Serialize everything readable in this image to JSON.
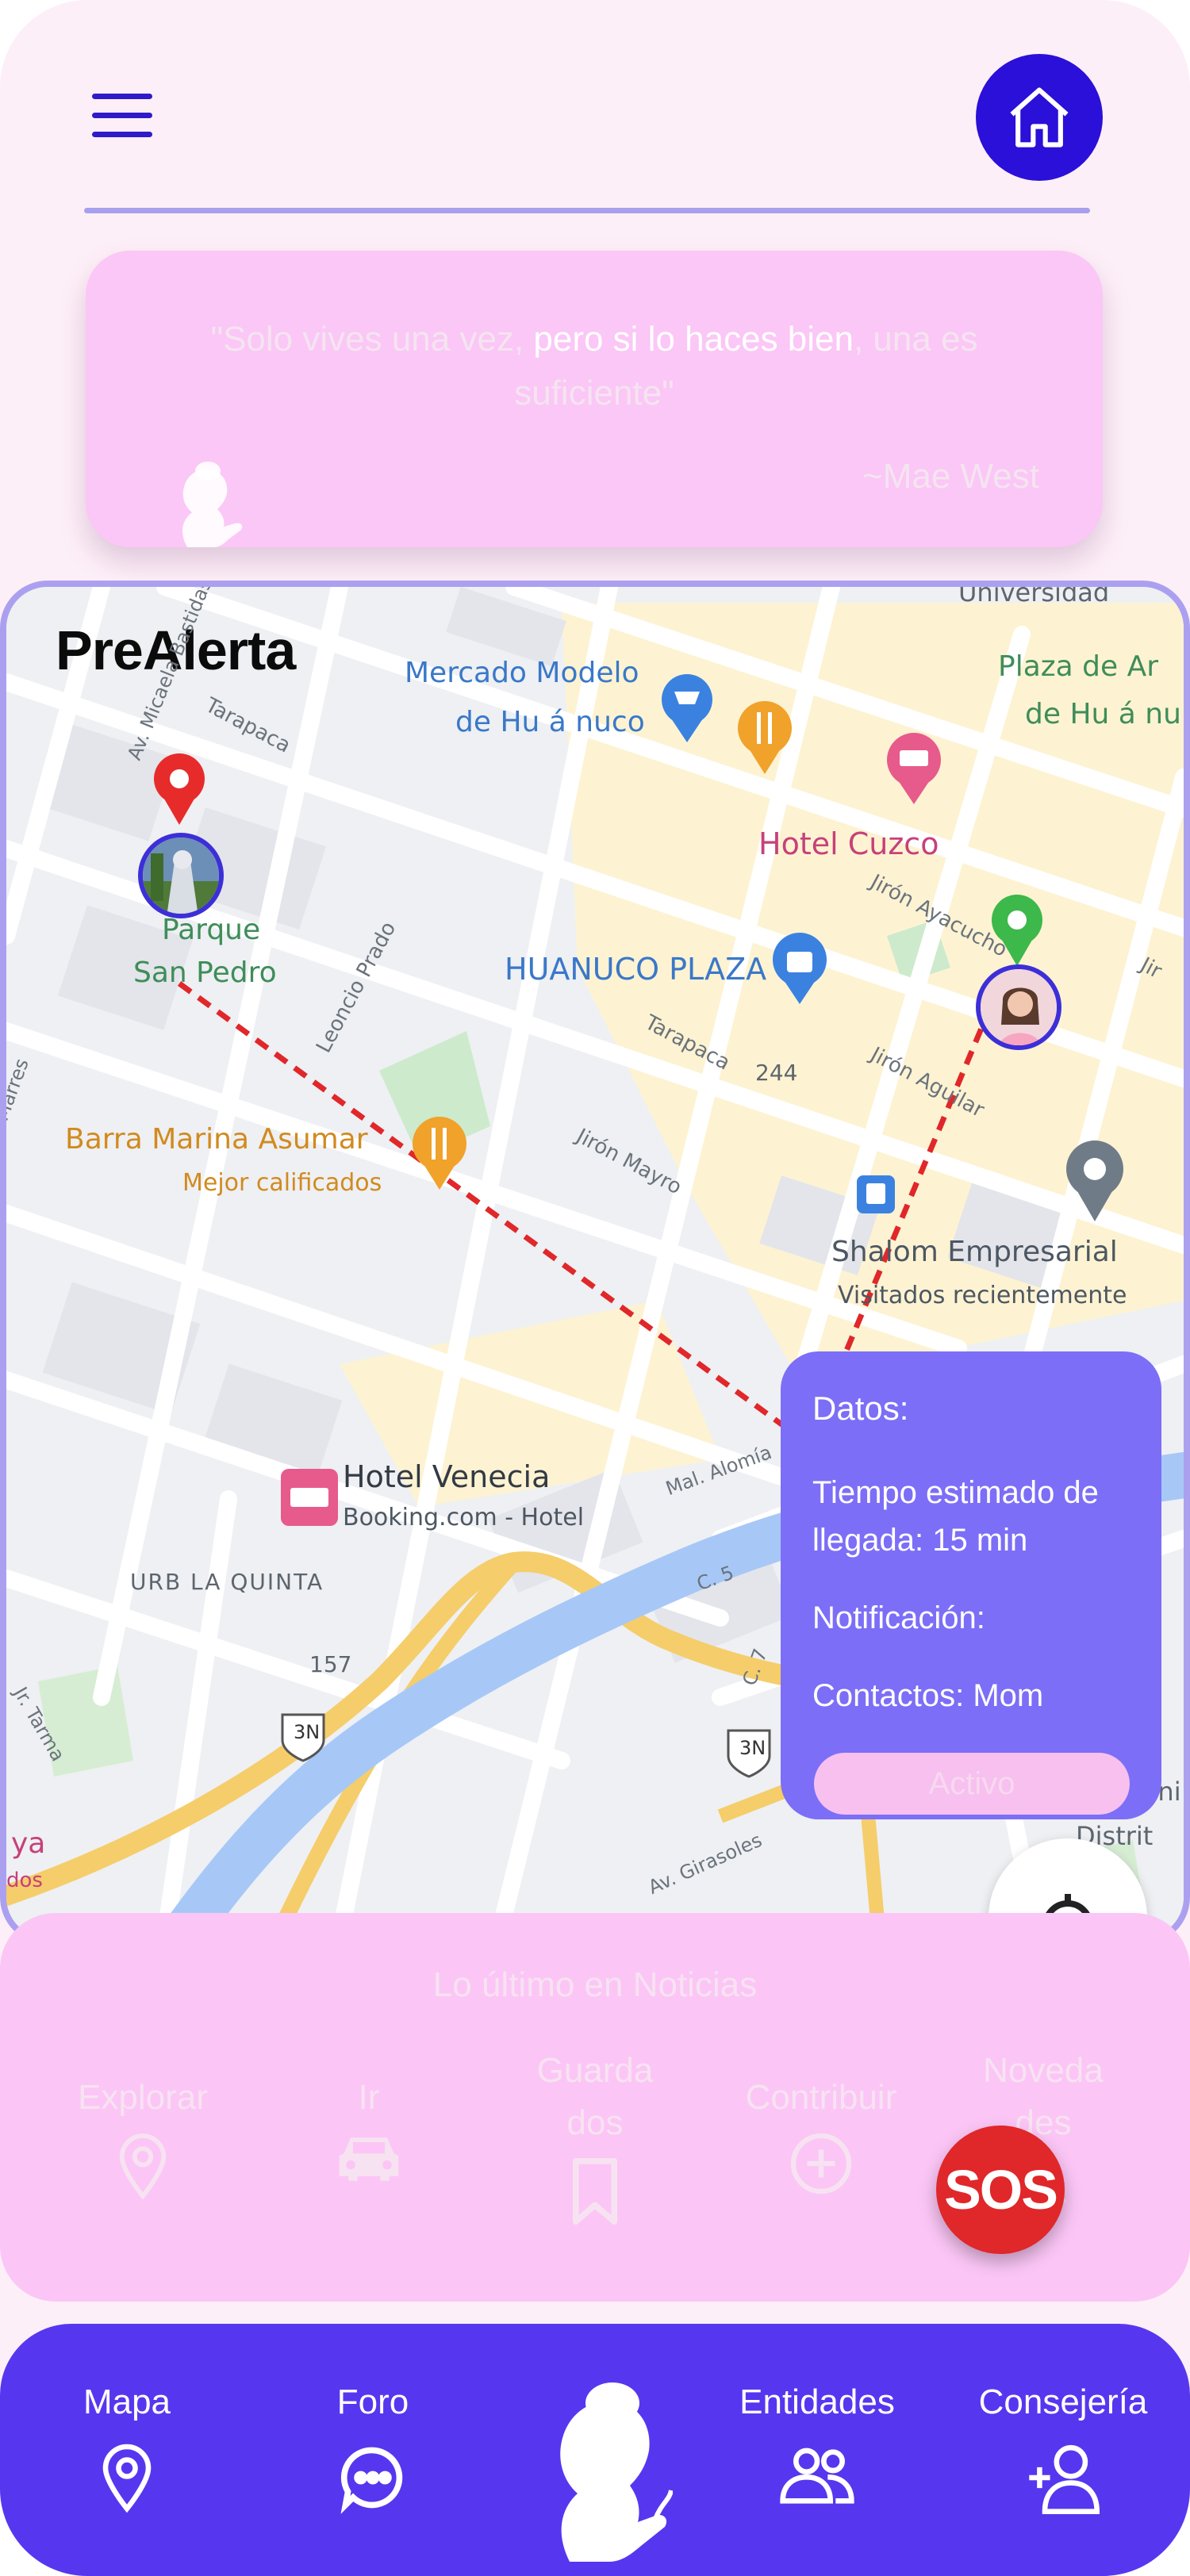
{
  "header": {
    "menu_icon": "hamburger-menu-icon",
    "home_icon": "home-icon"
  },
  "quote": {
    "part1": "\"Solo vives una vez, ",
    "highlight": "pero si lo haces bien",
    "part2": ", una es suficiente\"",
    "author": "~Mae West"
  },
  "map": {
    "app_title": "PreAlerta",
    "labels": {
      "mercado1": "Mercado Modelo",
      "mercado2": "de Hu á nuco",
      "plaza1": "Plaza de Ar",
      "plaza2": "de Hu á nu",
      "hotel_cuzco": "Hotel Cuzco",
      "parque1": "Parque",
      "parque2": "San Pedro",
      "huanuco_plaza": "HUANUCO PLAZA",
      "barra1": "Barra Marina Asumar",
      "barra2": "Mejor calificados",
      "shalom1": "Shalom Empresarial",
      "shalom2": "Visitados recientemente",
      "venecia1": "Hotel Venecia",
      "venecia2": "Booking.com - Hotel",
      "urb": "URB LA QUINTA",
      "n157": "157",
      "n244": "244",
      "r3n": "3N",
      "universidad": "Universidad",
      "tarapaca1": "Tarapaca",
      "tarapaca2": "Tarapaca",
      "jr_ayacucho": "Jirón Ayacucho",
      "jr_aguilar": "Jirón Aguilar",
      "jr_mayro": "Jirón Mayro",
      "leoncio_prado": "Leoncio Prado",
      "av_micaela": "Av. Micaela Bastidas",
      "mal_alomia": "Mal. Alomía",
      "c5": "C. 5",
      "c7": "C. 7",
      "av_girasoles": "Av. Girasoles",
      "jr_tarma": "Jr. Tarma",
      "edge_ya": "ya",
      "edge_dos": "dos",
      "edge_dist": "Distrit",
      "edge_uni": "Uni",
      "edge_jir": "Jir",
      "edge_marres": "Marres"
    }
  },
  "datos": {
    "title": "Datos:",
    "eta": "Tiempo estimado de llegada: 15 min",
    "notification": "Notificación:",
    "contacts": "Contactos: Mom",
    "active_button": "Activo"
  },
  "news": {
    "title": "Lo último en Noticias",
    "items": [
      {
        "label": "Explorar",
        "icon": "location-pin-icon"
      },
      {
        "label": "Ir",
        "icon": "car-icon"
      },
      {
        "label": "Guarda dos",
        "icon": "bookmark-icon"
      },
      {
        "label": "Contribuir",
        "icon": "plus-circle-icon"
      },
      {
        "label": "Noveda des",
        "icon": "bell-icon"
      }
    ]
  },
  "sos": {
    "label": "SOS"
  },
  "bottom_nav": {
    "items": [
      {
        "label": "Mapa",
        "icon": "location-pin-icon"
      },
      {
        "label": "Foro",
        "icon": "chat-bubble-icon"
      },
      {
        "label": "Entidades",
        "icon": "group-icon"
      },
      {
        "label": "Consejería",
        "icon": "add-user-icon"
      }
    ],
    "center_icon": "woman-silhouette-logo"
  },
  "colors": {
    "background": "#fdeff7",
    "primary": "#2a10d8",
    "nav": "#5637ef",
    "panel": "#7c6ef7",
    "pink": "#fbc7f6",
    "sos": "#e0272a",
    "route": "#e0272a"
  }
}
